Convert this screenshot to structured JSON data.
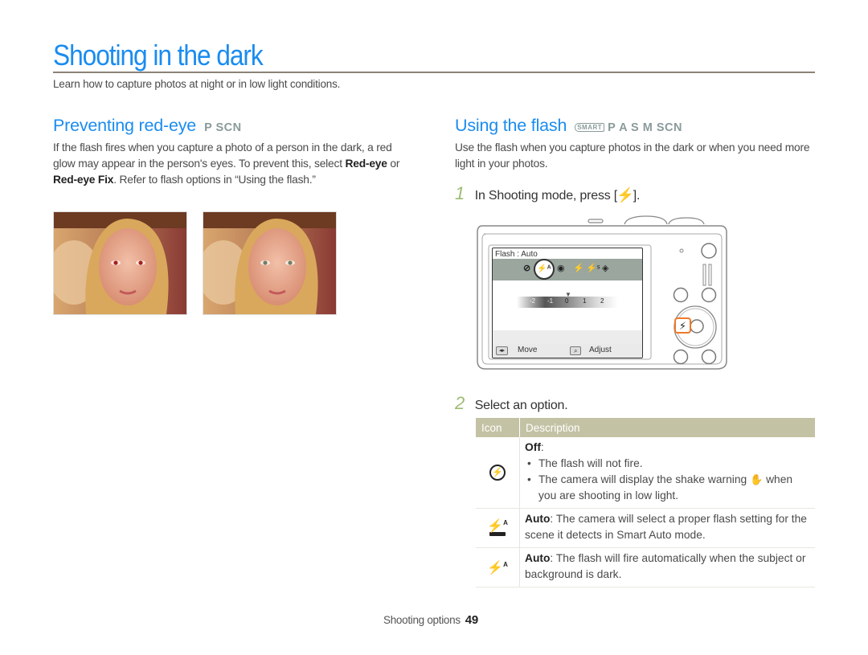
{
  "page": {
    "title": "Shooting in the dark",
    "intro": "Learn how to capture photos at night or in low light conditions."
  },
  "red_eye": {
    "title": "Preventing red-eye",
    "modes": "P SCN",
    "para_1": "If the flash fires when you capture a photo of a person in the dark, a red glow may appear in the person's eyes. To prevent this, select ",
    "bold_1": "Red-eye",
    "para_2": " or ",
    "bold_2": "Red-eye Fix",
    "para_3": ". Refer to flash options in “Using the flash.”",
    "photos": [
      {
        "label": "red-eye photo",
        "eye_color": "#a8201c"
      },
      {
        "label": "red-eye fixed photo",
        "eye_color": "#6f7f64"
      }
    ]
  },
  "flash": {
    "title": "Using the flash",
    "smart_badge": "SMART",
    "modes": "P A S M SCN",
    "intro": "Use the flash when you capture photos in the dark or when you need more light in your photos.",
    "step1_num": "1",
    "step1_pre": "In Shooting mode, press [",
    "step1_key": "⚡",
    "step1_post": "].",
    "step2_num": "2",
    "step2_text": "Select an option.",
    "camera_screen": {
      "label": "Flash : Auto",
      "icons": [
        "flash-off",
        "flash-auto",
        "red-eye",
        "fill-in",
        "slow-sync",
        "red-eye-fix"
      ],
      "selected_icon": "flash-auto",
      "scale_ticks": [
        "-2",
        "-1",
        "0",
        "1",
        "2"
      ],
      "scale_value": 0,
      "move_label": "Move",
      "adjust_label": "Adjust"
    },
    "highlight_color": "#f07828"
  },
  "table": {
    "headers": [
      "Icon",
      "Description"
    ],
    "header_color": "#c3c2a4",
    "rows": [
      {
        "icon": "flash-off-icon",
        "glyph": "⚡",
        "title": "Off",
        "bullets": [
          "The flash will not fire.",
          "The camera will display the shake warning",
          " when you are shooting in low light."
        ]
      },
      {
        "icon": "smart-flash-auto-icon",
        "glyph": "⚡",
        "sup": "A",
        "title": "Auto",
        "text": ": The camera will select a proper flash setting for the scene it detects in Smart Auto mode."
      },
      {
        "icon": "flash-auto-icon",
        "glyph": "⚡",
        "sup": "A",
        "title": "Auto",
        "text": ": The flash will fire automatically when the subject or background is dark."
      }
    ]
  },
  "footer": {
    "section": "Shooting options",
    "page_number": "49"
  }
}
